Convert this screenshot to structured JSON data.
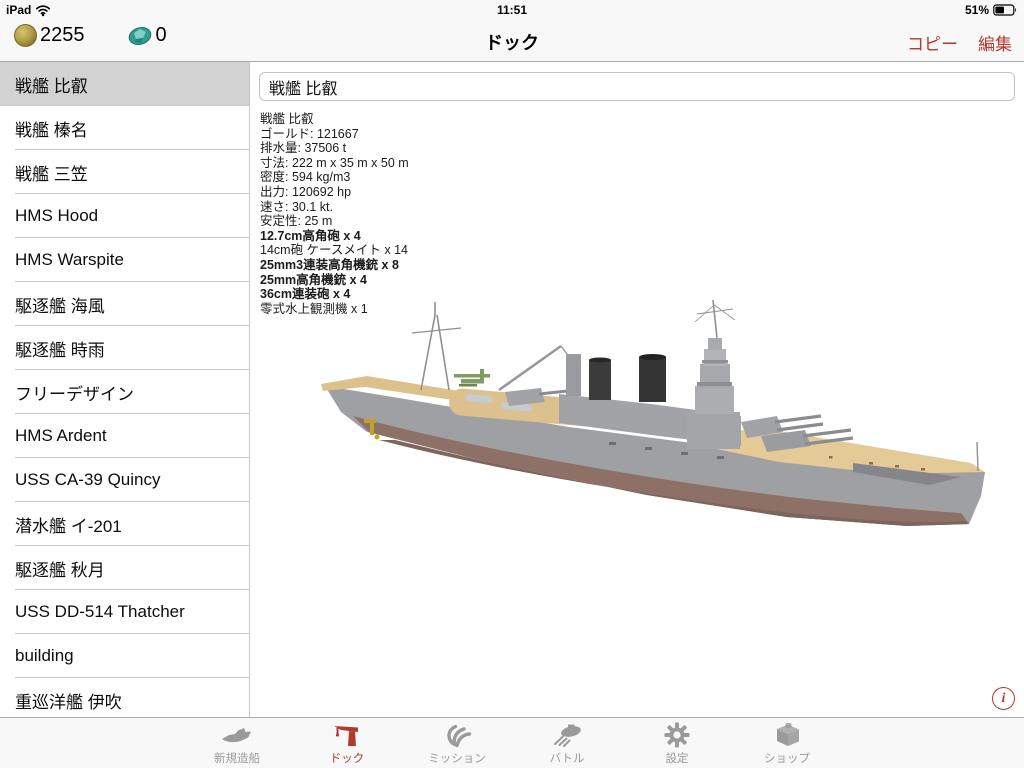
{
  "status_bar": {
    "carrier": "iPad",
    "time": "11:51",
    "battery": "51%"
  },
  "nav_bar": {
    "title": "ドック",
    "copy_label": "コピー",
    "edit_label": "編集",
    "gold_count": "2255",
    "gem_count": "0"
  },
  "sidebar": {
    "items": [
      {
        "label": "戦艦 比叡",
        "selected": true
      },
      {
        "label": "戦艦 榛名",
        "selected": false
      },
      {
        "label": "戦艦 三笠",
        "selected": false
      },
      {
        "label": "HMS Hood",
        "selected": false
      },
      {
        "label": "HMS Warspite",
        "selected": false
      },
      {
        "label": "駆逐艦 海風",
        "selected": false
      },
      {
        "label": "駆逐艦 時雨",
        "selected": false
      },
      {
        "label": "フリーデザイン",
        "selected": false
      },
      {
        "label": "HMS Ardent",
        "selected": false
      },
      {
        "label": "USS CA-39 Quincy",
        "selected": false
      },
      {
        "label": "潜水艦 イ-201",
        "selected": false
      },
      {
        "label": "駆逐艦 秋月",
        "selected": false
      },
      {
        "label": "USS DD-514 Thatcher",
        "selected": false
      },
      {
        "label": "building",
        "selected": false
      },
      {
        "label": "重巡洋艦 伊吹",
        "selected": false
      }
    ]
  },
  "main": {
    "ship_name_field": "戦艦 比叡",
    "stats": [
      {
        "text": "戦艦 比叡",
        "bold": false
      },
      {
        "text": "ゴールド: 121667",
        "bold": false
      },
      {
        "text": "排水量: 37506 t",
        "bold": false
      },
      {
        "text": "寸法: 222 m x 35 m x 50 m",
        "bold": false
      },
      {
        "text": "密度: 594 kg/m3",
        "bold": false
      },
      {
        "text": "出力: 120692 hp",
        "bold": false
      },
      {
        "text": "速さ: 30.1 kt.",
        "bold": false
      },
      {
        "text": "安定性: 25 m",
        "bold": false
      },
      {
        "text": "12.7cm高角砲 x 4",
        "bold": true
      },
      {
        "text": "14cm砲 ケースメイト x 14",
        "bold": false
      },
      {
        "text": "25mm3連装高角機銃 x 8",
        "bold": true
      },
      {
        "text": "25mm高角機銃 x 4",
        "bold": true
      },
      {
        "text": "36cm連装砲 x 4",
        "bold": true
      },
      {
        "text": "零式水上観測機 x 1",
        "bold": false
      }
    ],
    "info_button_glyph": "i"
  },
  "tab_bar": {
    "tabs": [
      {
        "label": "新規造船",
        "icon": "new-ship-icon",
        "active": false
      },
      {
        "label": "ドック",
        "icon": "dock-crane-icon",
        "active": true
      },
      {
        "label": "ミッション",
        "icon": "mission-claw-icon",
        "active": false
      },
      {
        "label": "バトル",
        "icon": "battle-ship-icon",
        "active": false
      },
      {
        "label": "設定",
        "icon": "settings-gear-icon",
        "active": false
      },
      {
        "label": "ショップ",
        "icon": "shop-bag-icon",
        "active": false
      }
    ]
  },
  "colors": {
    "accent_red": "#b23a30",
    "selected_row_gray": "#d2d2d2",
    "bar_background": "#f8f8f8",
    "deck_tan": "#ddc18d",
    "hull_gray": "#9fa0a4",
    "hull_brown": "#8d7166",
    "funnel_dark": "#3a3a3a",
    "seaplane_green": "#7f9d60"
  }
}
